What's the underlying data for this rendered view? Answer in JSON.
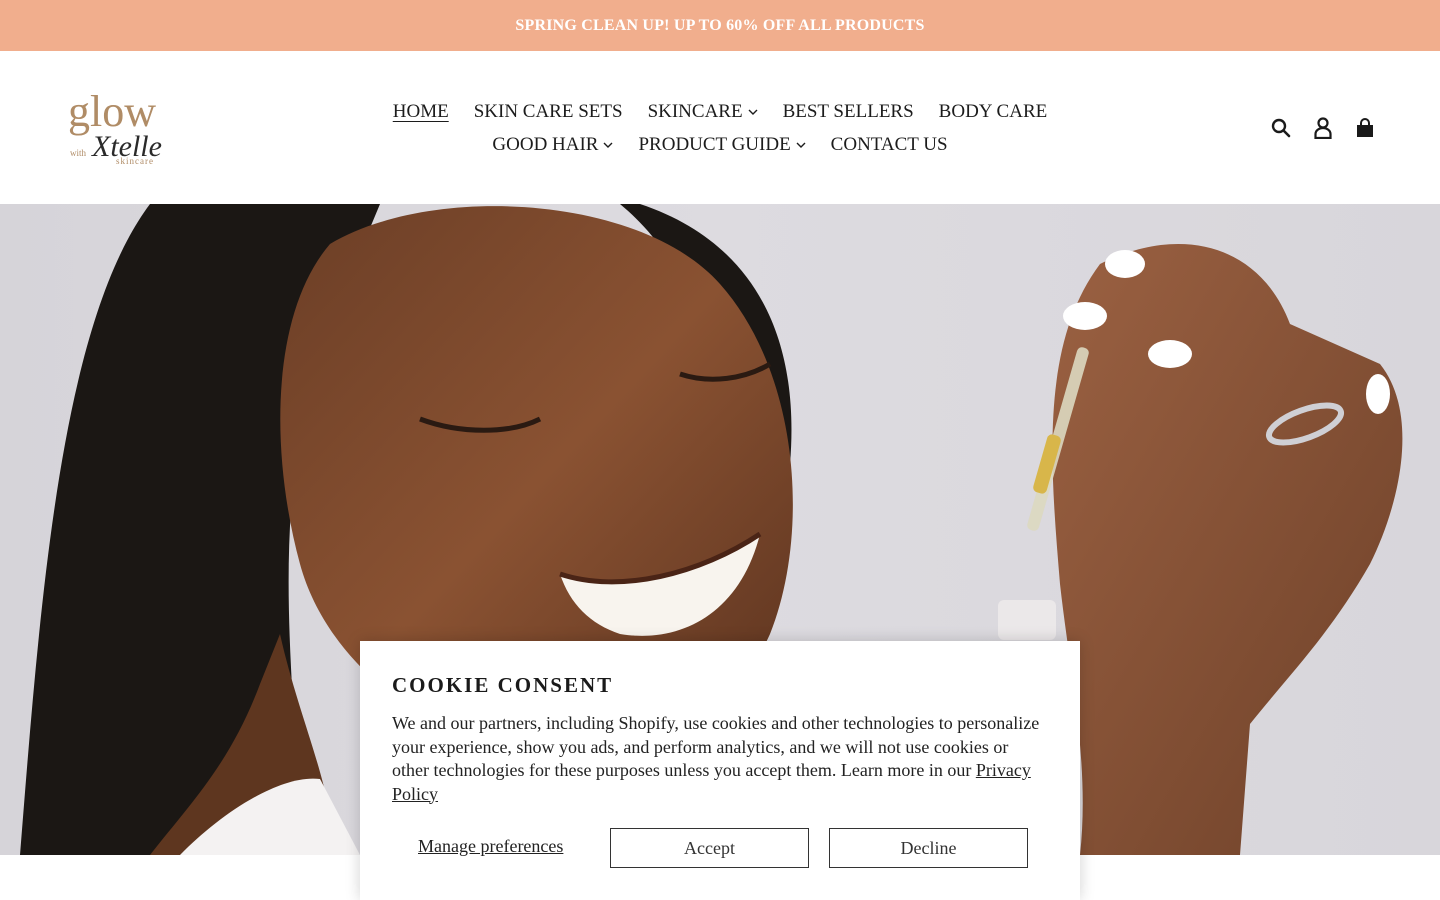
{
  "announcement": {
    "text": "SPRING CLEAN UP! UP TO 60% OFF ALL PRODUCTS"
  },
  "logo": {
    "word1": "glow",
    "word2": "Xtelle",
    "small_left": "with",
    "small_right": "skincare",
    "color": "#b08c66"
  },
  "nav": {
    "row1": [
      {
        "label": "HOME",
        "active": true
      },
      {
        "label": "SKIN CARE SETS"
      },
      {
        "label": "SKINCARE",
        "dropdown": true
      },
      {
        "label": "BEST SELLERS"
      },
      {
        "label": "BODY CARE"
      }
    ],
    "row2": [
      {
        "label": "GOOD HAIR",
        "dropdown": true
      },
      {
        "label": "PRODUCT GUIDE",
        "dropdown": true
      },
      {
        "label": "CONTACT US"
      }
    ]
  },
  "header_icons": [
    "search-icon",
    "account-icon",
    "cart-icon"
  ],
  "cookie": {
    "title": "COOKIE CONSENT",
    "body": "We and our partners, including Shopify, use cookies and other technologies to personalize your experience, show you ads, and perform analytics, and we will not use cookies or other technologies for these purposes unless you accept them. Learn more in our ",
    "link": "Privacy Policy",
    "manage": "Manage preferences",
    "accept": "Accept",
    "decline": "Decline"
  },
  "colors": {
    "announcement_bg": "#f1ae8d",
    "logo_gold": "#b08c66"
  }
}
